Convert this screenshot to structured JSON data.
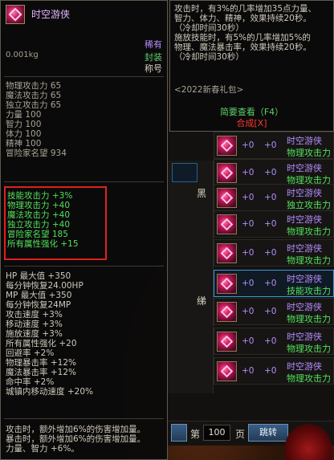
{
  "item": {
    "name": "时空游侠",
    "rarity": "稀有",
    "weight": "0.001kg",
    "seal": "封装",
    "title_tag": "称号",
    "base_stats": [
      "物理攻击力 65",
      "魔法攻击力 65",
      "独立攻击力 65",
      "力量 100",
      "智力 100",
      "体力 100",
      "精神 100",
      "冒险家名望 934"
    ],
    "enhance_stats": [
      "技能攻击力 +3%",
      "物理攻击力 +40",
      "魔法攻击力 +40",
      "独立攻击力 +40",
      "冒险家名望 185",
      "所有属性强化 +15"
    ],
    "extra_stats": [
      "HP 最大值 +350",
      "每分钟恢复24.00HP",
      "MP 最大值 +350",
      "每分钟恢复24MP",
      "攻击速度 +3%",
      "移动速度 +3%",
      "施放速度 +3%",
      "所有属性强化 +20",
      "回避率 +2%",
      "物理暴击率 +12%",
      "魔法暴击率 +12%",
      "命中率 +2%",
      "城镇内移动速度 +20%"
    ],
    "desc": [
      "攻击时，额外增加6%的伤害增加量。",
      "暴击时，额外增加6%的伤害增加量。",
      "力量、智力 +6%。"
    ]
  },
  "set_tooltip": {
    "lines": [
      "攻击时，有3%的几率增加35点力量、",
      "智力、体力、精神，效果持续20秒。",
      "（冷却时间30秒）",
      "施放技能时，有5%的几率增加5%的",
      "物理、魔法暴击率，效果持续20秒。",
      "（冷却时间30秒）"
    ],
    "gift_tag": "<2022新春礼包>",
    "quick_view": "简要查看（F4）",
    "synthesize": "合成[X]"
  },
  "list": {
    "side_glyph_1": "黑",
    "side_glyph_2": "绨",
    "rows": [
      {
        "p1": "+0",
        "p2": "+0",
        "name": "时空游侠",
        "sub": "物理攻击力",
        "selected": false
      },
      {
        "p1": "+0",
        "p2": "+0",
        "name": "时空游侠",
        "sub": "物理攻击力",
        "selected": false
      },
      {
        "p1": "+0",
        "p2": "+0",
        "name": "时空游侠",
        "sub": "独立攻击力",
        "selected": false
      },
      {
        "p1": "+0",
        "p2": "+0",
        "name": "时空游侠",
        "sub": "物理攻击力",
        "selected": false
      },
      {
        "p1": "+0",
        "p2": "+0",
        "name": "时空游侠",
        "sub": "物理攻击力",
        "selected": false
      },
      {
        "p1": "+0",
        "p2": "+0",
        "name": "时空游侠",
        "sub": "技能攻击力",
        "selected": true
      },
      {
        "p1": "+0",
        "p2": "+0",
        "name": "时空游侠",
        "sub": "物理攻击力",
        "selected": false
      },
      {
        "p1": "+0",
        "p2": "+0",
        "name": "时空游侠",
        "sub": "物理攻击力",
        "selected": false
      },
      {
        "p1": "+0",
        "p2": "+0",
        "name": "时空游侠",
        "sub": "物理攻击力",
        "selected": false
      }
    ]
  },
  "pager": {
    "prefix": "第",
    "page": "100",
    "suffix": "页",
    "jump": "跳转"
  }
}
